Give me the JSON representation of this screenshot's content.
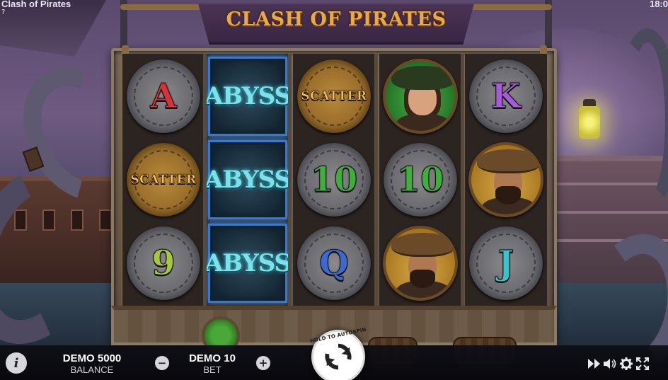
{
  "window": {
    "game_title": "Clash of Pirates",
    "title_suffix": "?",
    "clock": "18:0"
  },
  "logo": {
    "text": "CLASH OF PIRATES"
  },
  "reels": [
    [
      {
        "type": "coin",
        "label": "A",
        "color": "red"
      },
      {
        "type": "coin-gold",
        "label": "SCATTER"
      },
      {
        "type": "coin",
        "label": "9",
        "color": "lime"
      }
    ],
    [
      {
        "type": "wild",
        "label": "ABYSS"
      },
      {
        "type": "wild",
        "label": "ABYSS"
      },
      {
        "type": "wild",
        "label": "ABYSS"
      }
    ],
    [
      {
        "type": "coin-gold",
        "label": "SCATTER"
      },
      {
        "type": "coin",
        "label": "10",
        "color": "green"
      },
      {
        "type": "coin",
        "label": "Q",
        "color": "blue"
      }
    ],
    [
      {
        "type": "portrait",
        "label": "female pirate"
      },
      {
        "type": "coin",
        "label": "10",
        "color": "green"
      },
      {
        "type": "portrait",
        "label": "bearded pirate"
      }
    ],
    [
      {
        "type": "coin",
        "label": "K",
        "color": "purple"
      },
      {
        "type": "portrait",
        "label": "bearded pirate"
      },
      {
        "type": "coin",
        "label": "J",
        "color": "cyan"
      }
    ]
  ],
  "bottom_bar": {
    "info_label": "i",
    "balance": {
      "value": "DEMO 5000",
      "label": "BALANCE"
    },
    "bet": {
      "value": "DEMO 10",
      "label": "BET",
      "decrease": "−",
      "increase": "+"
    },
    "spin": {
      "hint": "HOLD TO AUTOSPIN"
    },
    "tools": [
      "fast-forward-icon",
      "sound-icon",
      "settings-gear-icon",
      "fullscreen-icon"
    ]
  },
  "colors": {
    "red": "#d8333d",
    "purple": "#a65cd8",
    "green": "#3fae3a",
    "lime": "#a6c83a",
    "blue": "#3b6ad6",
    "cyan": "#3cc4cc",
    "logo": "#e8a94a",
    "wild_glow": "#3b8ae8"
  }
}
